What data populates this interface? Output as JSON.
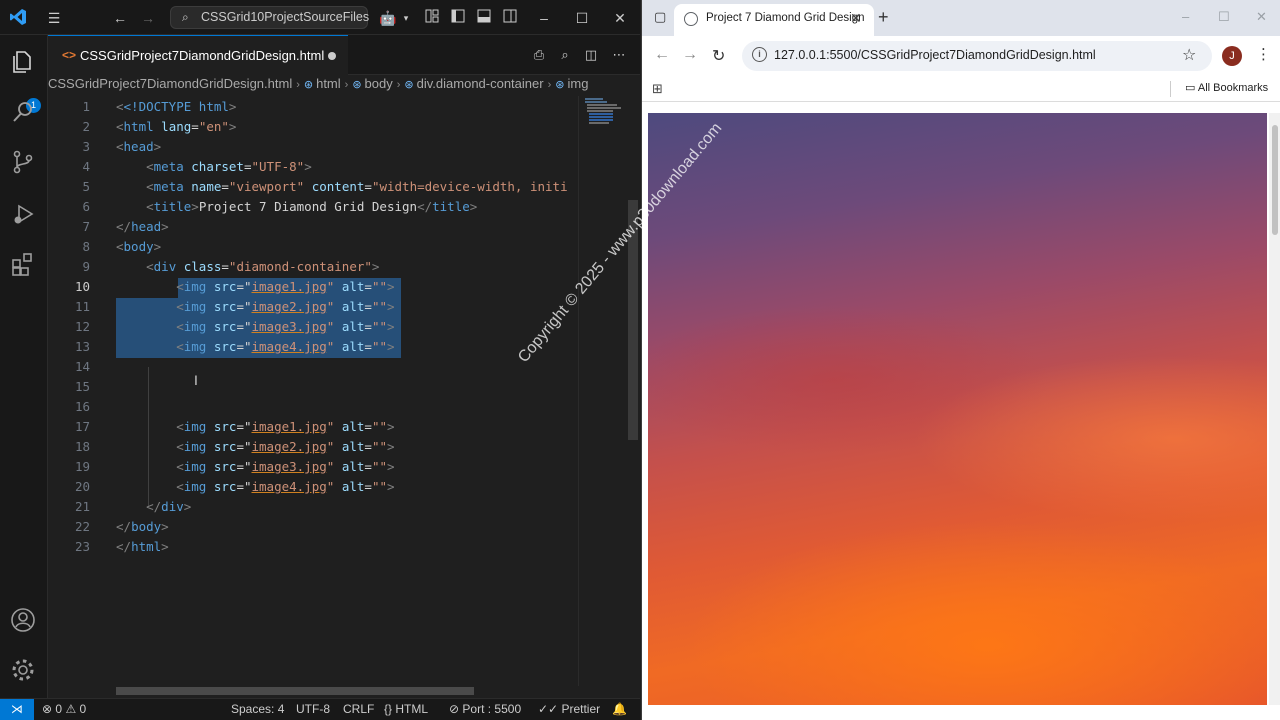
{
  "vscode": {
    "command_center": "CSSGrid10ProjectSourceFiles",
    "explorer_badge": "1",
    "tab": {
      "label": "CSSGridProject7DiamondGridDesign.html"
    },
    "breadcrumb": [
      "CSSGridProject7DiamondGridDesign.html",
      "html",
      "body",
      "div.diamond-container",
      "img"
    ],
    "current_line": "10",
    "lines": [
      {
        "n": "1"
      },
      {
        "n": "2"
      },
      {
        "n": "3"
      },
      {
        "n": "4"
      },
      {
        "n": "5"
      },
      {
        "n": "6"
      },
      {
        "n": "7"
      },
      {
        "n": "8"
      },
      {
        "n": "9"
      },
      {
        "n": "10"
      },
      {
        "n": "11"
      },
      {
        "n": "12"
      },
      {
        "n": "13"
      },
      {
        "n": "14"
      },
      {
        "n": "15"
      },
      {
        "n": "16"
      },
      {
        "n": "17"
      },
      {
        "n": "18"
      },
      {
        "n": "19"
      },
      {
        "n": "20"
      },
      {
        "n": "21"
      },
      {
        "n": "22"
      },
      {
        "n": "23"
      }
    ],
    "code": {
      "doctype": "<!DOCTYPE",
      "doctype_html": "html",
      "html_open": "html",
      "lang_attr": "lang",
      "lang_val": "\"en\"",
      "head": "head",
      "meta": "meta",
      "charset_attr": "charset",
      "charset_val": "\"UTF-8\"",
      "name_attr": "name",
      "name_val": "\"viewport\"",
      "content_attr": "content",
      "content_val": "\"width=device-width, initi",
      "title": "title",
      "title_text": "Project 7 Diamond Grid Design",
      "body": "body",
      "div": "div",
      "class_attr": "class",
      "class_val": "\"diamond-container\"",
      "img": "img",
      "src_attr": "src",
      "alt_attr": "alt",
      "alt_val": "\"\"",
      "images": [
        "image1.jpg",
        "image2.jpg",
        "image3.jpg",
        "image4.jpg"
      ]
    },
    "status": {
      "problems": "0",
      "warnings": "0",
      "spaces": "Spaces: 4",
      "encoding": "UTF-8",
      "eol": "CRLF",
      "language": "HTML",
      "port": "Port : 5500",
      "prettier": "Prettier"
    }
  },
  "chrome": {
    "tab_title": "Project 7 Diamond Grid Design",
    "url": "127.0.0.1:5500/CSSGridProject7DiamondGridDesign.html",
    "avatar_letter": "J",
    "all_bookmarks": "All Bookmarks",
    "watermark": "Copyright © 2025 - www.p30download.com"
  },
  "colors": {
    "accent": "#0078d4",
    "selection": "#264f78",
    "tag": "#569cd6",
    "attr": "#9cdcfe",
    "string": "#ce9178"
  }
}
